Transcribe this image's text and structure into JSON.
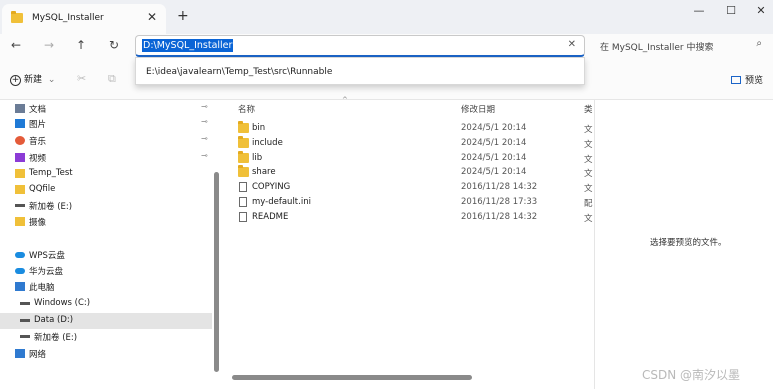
{
  "window": {
    "tab_title": "MySQL_Installer",
    "tab_close": "✕",
    "new_tab": "+",
    "minimize": "—",
    "maximize": "☐",
    "close": "✕"
  },
  "nav": {
    "back": "←",
    "forward": "→",
    "up": "↑",
    "refresh": "↻",
    "address": "D:\\MySQL_Installer",
    "address_clear": "✕",
    "suggestion": "E:\\idea\\javalearn\\Temp_Test\\src\\Runnable",
    "search_placeholder": "在 MySQL_Installer 中搜索",
    "search_icon": "⌕"
  },
  "toolbar": {
    "new_label": "新建",
    "new_plus": "+",
    "new_caret": "⌄",
    "cut_icon": "✂",
    "copy_icon": "⧉",
    "preview_label": "预览"
  },
  "sidebar": {
    "items": [
      {
        "label": "文档",
        "icon": "documents-icon",
        "pinned": true
      },
      {
        "label": "图片",
        "icon": "pictures-icon",
        "pinned": true
      },
      {
        "label": "音乐",
        "icon": "music-icon",
        "pinned": true
      },
      {
        "label": "视频",
        "icon": "videos-icon",
        "pinned": true
      },
      {
        "label": "Temp_Test",
        "icon": "folder-icon",
        "pinned": false
      },
      {
        "label": "QQfile",
        "icon": "folder-icon",
        "pinned": false
      },
      {
        "label": "新加卷 (E:)",
        "icon": "drive-icon",
        "pinned": false
      },
      {
        "label": "摄像",
        "icon": "folder-icon",
        "pinned": false
      },
      {
        "label": "WPS云盘",
        "icon": "cloud-icon",
        "pinned": false
      },
      {
        "label": "华为云盘",
        "icon": "cloud-icon",
        "pinned": false
      },
      {
        "label": "此电脑",
        "icon": "computer-icon",
        "pinned": false
      },
      {
        "label": "Windows (C:)",
        "icon": "drive-icon",
        "pinned": false
      },
      {
        "label": "Data (D:)",
        "icon": "drive-icon",
        "pinned": false
      },
      {
        "label": "新加卷 (E:)",
        "icon": "drive-icon",
        "pinned": false
      },
      {
        "label": "网络",
        "icon": "network-icon",
        "pinned": false
      }
    ],
    "pin_glyph": "📌"
  },
  "columns": {
    "name": "名称",
    "date": "修改日期",
    "type": "类"
  },
  "files": [
    {
      "name": "bin",
      "date": "2024/5/1 20:14",
      "type": "文",
      "kind": "folder"
    },
    {
      "name": "include",
      "date": "2024/5/1 20:14",
      "type": "文",
      "kind": "folder"
    },
    {
      "name": "lib",
      "date": "2024/5/1 20:14",
      "type": "文",
      "kind": "folder"
    },
    {
      "name": "share",
      "date": "2024/5/1 20:14",
      "type": "文",
      "kind": "folder"
    },
    {
      "name": "COPYING",
      "date": "2016/11/28 14:32",
      "type": "文",
      "kind": "file"
    },
    {
      "name": "my-default.ini",
      "date": "2016/11/28 17:33",
      "type": "配",
      "kind": "ini"
    },
    {
      "name": "README",
      "date": "2016/11/28 14:32",
      "type": "文",
      "kind": "file"
    }
  ],
  "preview": {
    "message": "选择要预览的文件。"
  },
  "watermark": "CSDN @南汐以墨"
}
